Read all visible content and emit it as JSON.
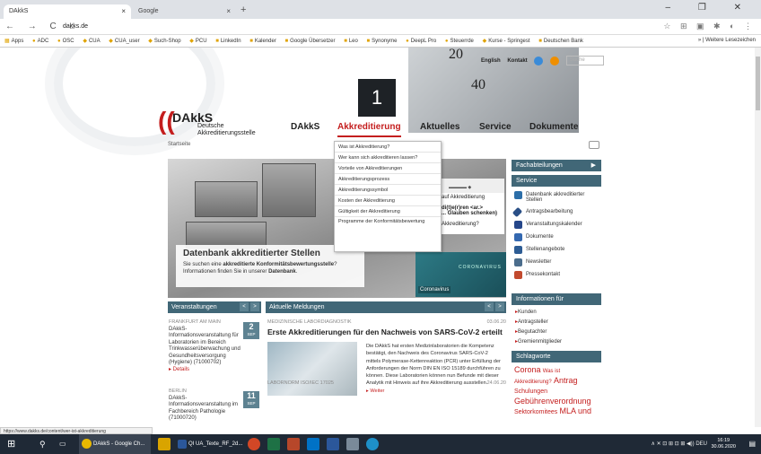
{
  "browser": {
    "tabs": [
      {
        "title": "DAkkS",
        "close": "×"
      },
      {
        "title": "Google",
        "close": "×"
      }
    ],
    "new_tab": "+",
    "window_controls": "– ❐ ✕",
    "nav_buttons": "← → C ⌂",
    "url": "dakks.de",
    "extensions": "☆ ⊞ ▣ ✱ ◐ ⋮",
    "bookmarks": [
      "Apps",
      "ADC",
      "OSC",
      "CUA",
      "CUA_user",
      "Such-Shop",
      "PCU",
      "LinkedIn",
      "Kalender",
      "Google Übersetzer",
      "Leo",
      "Synonyme",
      "DeepL Pro",
      "Steuerrde",
      "Kurse - Springest",
      "Deutschen Bank"
    ],
    "bookmarks_more": "» | Weitere Lesezeichen"
  },
  "site": {
    "gauge_numbers": [
      "20",
      "40"
    ],
    "hero_number": "1",
    "toplinks": {
      "english": "English",
      "kontakt": "Kontakt",
      "search_placeholder": "Suche"
    },
    "logo": {
      "name": "DAkkS",
      "sub1": "Deutsche",
      "sub2": "Akkreditierungsstelle"
    },
    "nav": [
      "DAkkS",
      "Akkreditierung",
      "Aktuelles",
      "Service",
      "Dokumente"
    ],
    "breadcrumb": "Startseite",
    "dropdown": [
      "Was ist Akkreditierung?",
      "Wer kann sich akkreditieren lassen?",
      "Vorteile von Akkreditierungen",
      "Akkreditierungsprozess",
      "Akkreditierungssymbol",
      "Kosten der Akkreditierung",
      "Gültigkeit der Akkreditierung",
      "Programme der Konformitätsbewertung"
    ],
    "slide": {
      "title": "Datenbank akkreditierter Stellen",
      "text_pre": "Sie suchen eine ",
      "text_bold": "akkreditierte Konformitätsbewertungsstelle",
      "text_post": "? Informationen finden Sie in unserer ",
      "text_link": "Datenbank",
      "side_line1": "auf Akkreditierung",
      "side_line2": "di(t)e(r)ren <ar.>",
      "side_line3": "... Glauben schenken)",
      "side_line4": "Akkreditierung?",
      "covid_label": "Coronavirus",
      "covid_banner": "CORONAVIRUS"
    },
    "right": {
      "fachabteilungen": "Fachabteilungen",
      "service_head": "Service",
      "service": [
        "Datenbank akkreditierter Stellen",
        "Antragsbearbeitung",
        "Veranstaltungskalender",
        "Dokumente",
        "Stellenangebote",
        "Newsletter",
        "Pressekontakt"
      ],
      "info_head": "Informationen für",
      "info": [
        "Kunden",
        "Antragsteller",
        "Begutachter",
        "Gremienmitglieder"
      ],
      "schlag_head": "Schlagworte",
      "schlagworte": [
        "Corona",
        "Was ist Akkreditierung?",
        "Antrag",
        "Schulungen",
        "Gebührenverordnung",
        "Sektorkomitees",
        "MLA und"
      ]
    },
    "veranstaltungen": {
      "head": "Veranstaltungen",
      "prev": "<",
      "next": ">",
      "events": [
        {
          "city": "FRANKFURT AM MAIN",
          "day": "2",
          "month": "SEP",
          "text": "DAkkS-Informationsveranstaltung für Laboratorien im Bereich Trinkwasserüberwachung und Gesundheitsversorgung (Hygiene) (71000702)",
          "details": "▸ Details"
        },
        {
          "city": "BERLIN",
          "day": "11",
          "month": "SEP",
          "text": "DAkkS-Informationsveranstaltung im Fachbereich Pathologie (71000720)",
          "details": ""
        }
      ]
    },
    "meldungen": {
      "head": "Aktuelle Meldungen",
      "prev": "<",
      "next": ">",
      "category": "MEDIZINISCHE LABORDIAGNOSTIK",
      "date": "03.06.20",
      "title": "Erste Akkreditierungen für den Nachweis von SARS-CoV-2 erteilt",
      "body": "Die DAkkS hat ersten Medizinlaboratorien die Kompetenz bestätigt, den Nachweis des Coronavirus SARS-CoV-2 mittels Polymerase-Kettenreaktion (PCR) unter Erfüllung der Anforderungen der Norm DIN EN ISO 15189 durchführen zu können. Diese Laboratorien können nun Befunde mit dieser Analytik mit Hinweis auf ihre Akkreditierung ausstellen.",
      "more": "▸ Weiter",
      "next_category": "LABORNORM ISO/IEC 17025",
      "next_date": "24.06.20"
    }
  },
  "status_url": "https://www.dakks.de/content/wer-ist-akkreditierung",
  "taskbar": {
    "apps": [
      "DAkkS - Google Ch...",
      "QI UA_Texte_RF_2d..."
    ],
    "tray": "∧ ✕ ⊡ ⊞ ⊡ ⊞ ◀)) DEU",
    "time": "16:19",
    "date": "30.06.2020"
  },
  "colors": {
    "brand_red": "#c41e1e",
    "panel_blue": "#416777",
    "taskbar": "#1f2936"
  }
}
